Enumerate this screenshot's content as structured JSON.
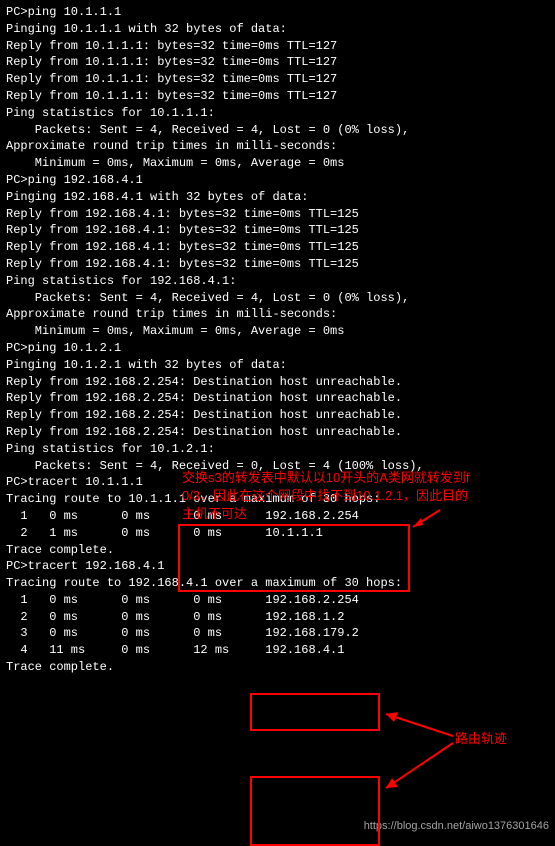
{
  "cmd1": "PC>ping 10.1.1.1",
  "blank": "",
  "pinging1": "Pinging 10.1.1.1 with 32 bytes of data:",
  "r1a": "Reply from 10.1.1.1: bytes=32 time=0ms TTL=127",
  "r1b": "Reply from 10.1.1.1: bytes=32 time=0ms TTL=127",
  "r1c": "Reply from 10.1.1.1: bytes=32 time=0ms TTL=127",
  "r1d": "Reply from 10.1.1.1: bytes=32 time=0ms TTL=127",
  "stats1": "Ping statistics for 10.1.1.1:",
  "pkts1": "    Packets: Sent = 4, Received = 4, Lost = 0 (0% loss),",
  "aprt1": "Approximate round trip times in milli-seconds:",
  "mma1": "    Minimum = 0ms, Maximum = 0ms, Average = 0ms",
  "cmd2": "PC>ping 192.168.4.1",
  "pinging2": "Pinging 192.168.4.1 with 32 bytes of data:",
  "r2a": "Reply from 192.168.4.1: bytes=32 time=0ms TTL=125",
  "r2b": "Reply from 192.168.4.1: bytes=32 time=0ms TTL=125",
  "r2c": "Reply from 192.168.4.1: bytes=32 time=0ms TTL=125",
  "r2d": "Reply from 192.168.4.1: bytes=32 time=0ms TTL=125",
  "stats2": "Ping statistics for 192.168.4.1:",
  "pkts2": "    Packets: Sent = 4, Received = 4, Lost = 0 (0% loss),",
  "aprt2": "Approximate round trip times in milli-seconds:",
  "mma2": "    Minimum = 0ms, Maximum = 0ms, Average = 0ms",
  "cmd3": "PC>ping 10.1.2.1",
  "pinging3": "Pinging 10.1.2.1 with 32 bytes of data:",
  "r3a": "Reply from 192.168.2.254: Destination host unreachable.",
  "r3b": "Reply from 192.168.2.254: Destination host unreachable.",
  "r3c": "Reply from 192.168.2.254: Destination host unreachable.",
  "r3d": "Reply from 192.168.2.254: Destination host unreachable.",
  "stats3": "Ping statistics for 10.1.2.1:",
  "pkts3": "    Packets: Sent = 4, Received = 0, Lost = 4 (100% loss),",
  "cmd4": "PC>tracert 10.1.1.1",
  "tracing4": "Tracing route to 10.1.1.1 over a maximum of 30 hops:",
  "t4a": "  1   0 ms      0 ms      0 ms      192.168.2.254",
  "t4b": "  2   1 ms      0 ms      0 ms      10.1.1.1",
  "tc4": "Trace complete.",
  "cmd5": "PC>tracert 192.168.4.1",
  "tracing5": "Tracing route to 192.168.4.1 over a maximum of 30 hops:",
  "t5a": "  1   0 ms      0 ms      0 ms      192.168.2.254",
  "t5b": "  2   0 ms      0 ms      0 ms      192.168.1.2",
  "t5c": "  3   0 ms      0 ms      0 ms      192.168.179.2",
  "t5d": "  4   11 ms     0 ms      12 ms     192.168.4.1",
  "tc5": "Trace complete.",
  "anno1_l1": "交换s3的转发表中默认以10开头的A类网就转发到f",
  "anno1_l2": "0/3，因此在这个网段中找不到10.1.2.1，因此目的",
  "anno1_l3": "主机不可达",
  "anno2": "路由轨迹",
  "watermark": "https://blog.csdn.net/aiwo1376301646"
}
